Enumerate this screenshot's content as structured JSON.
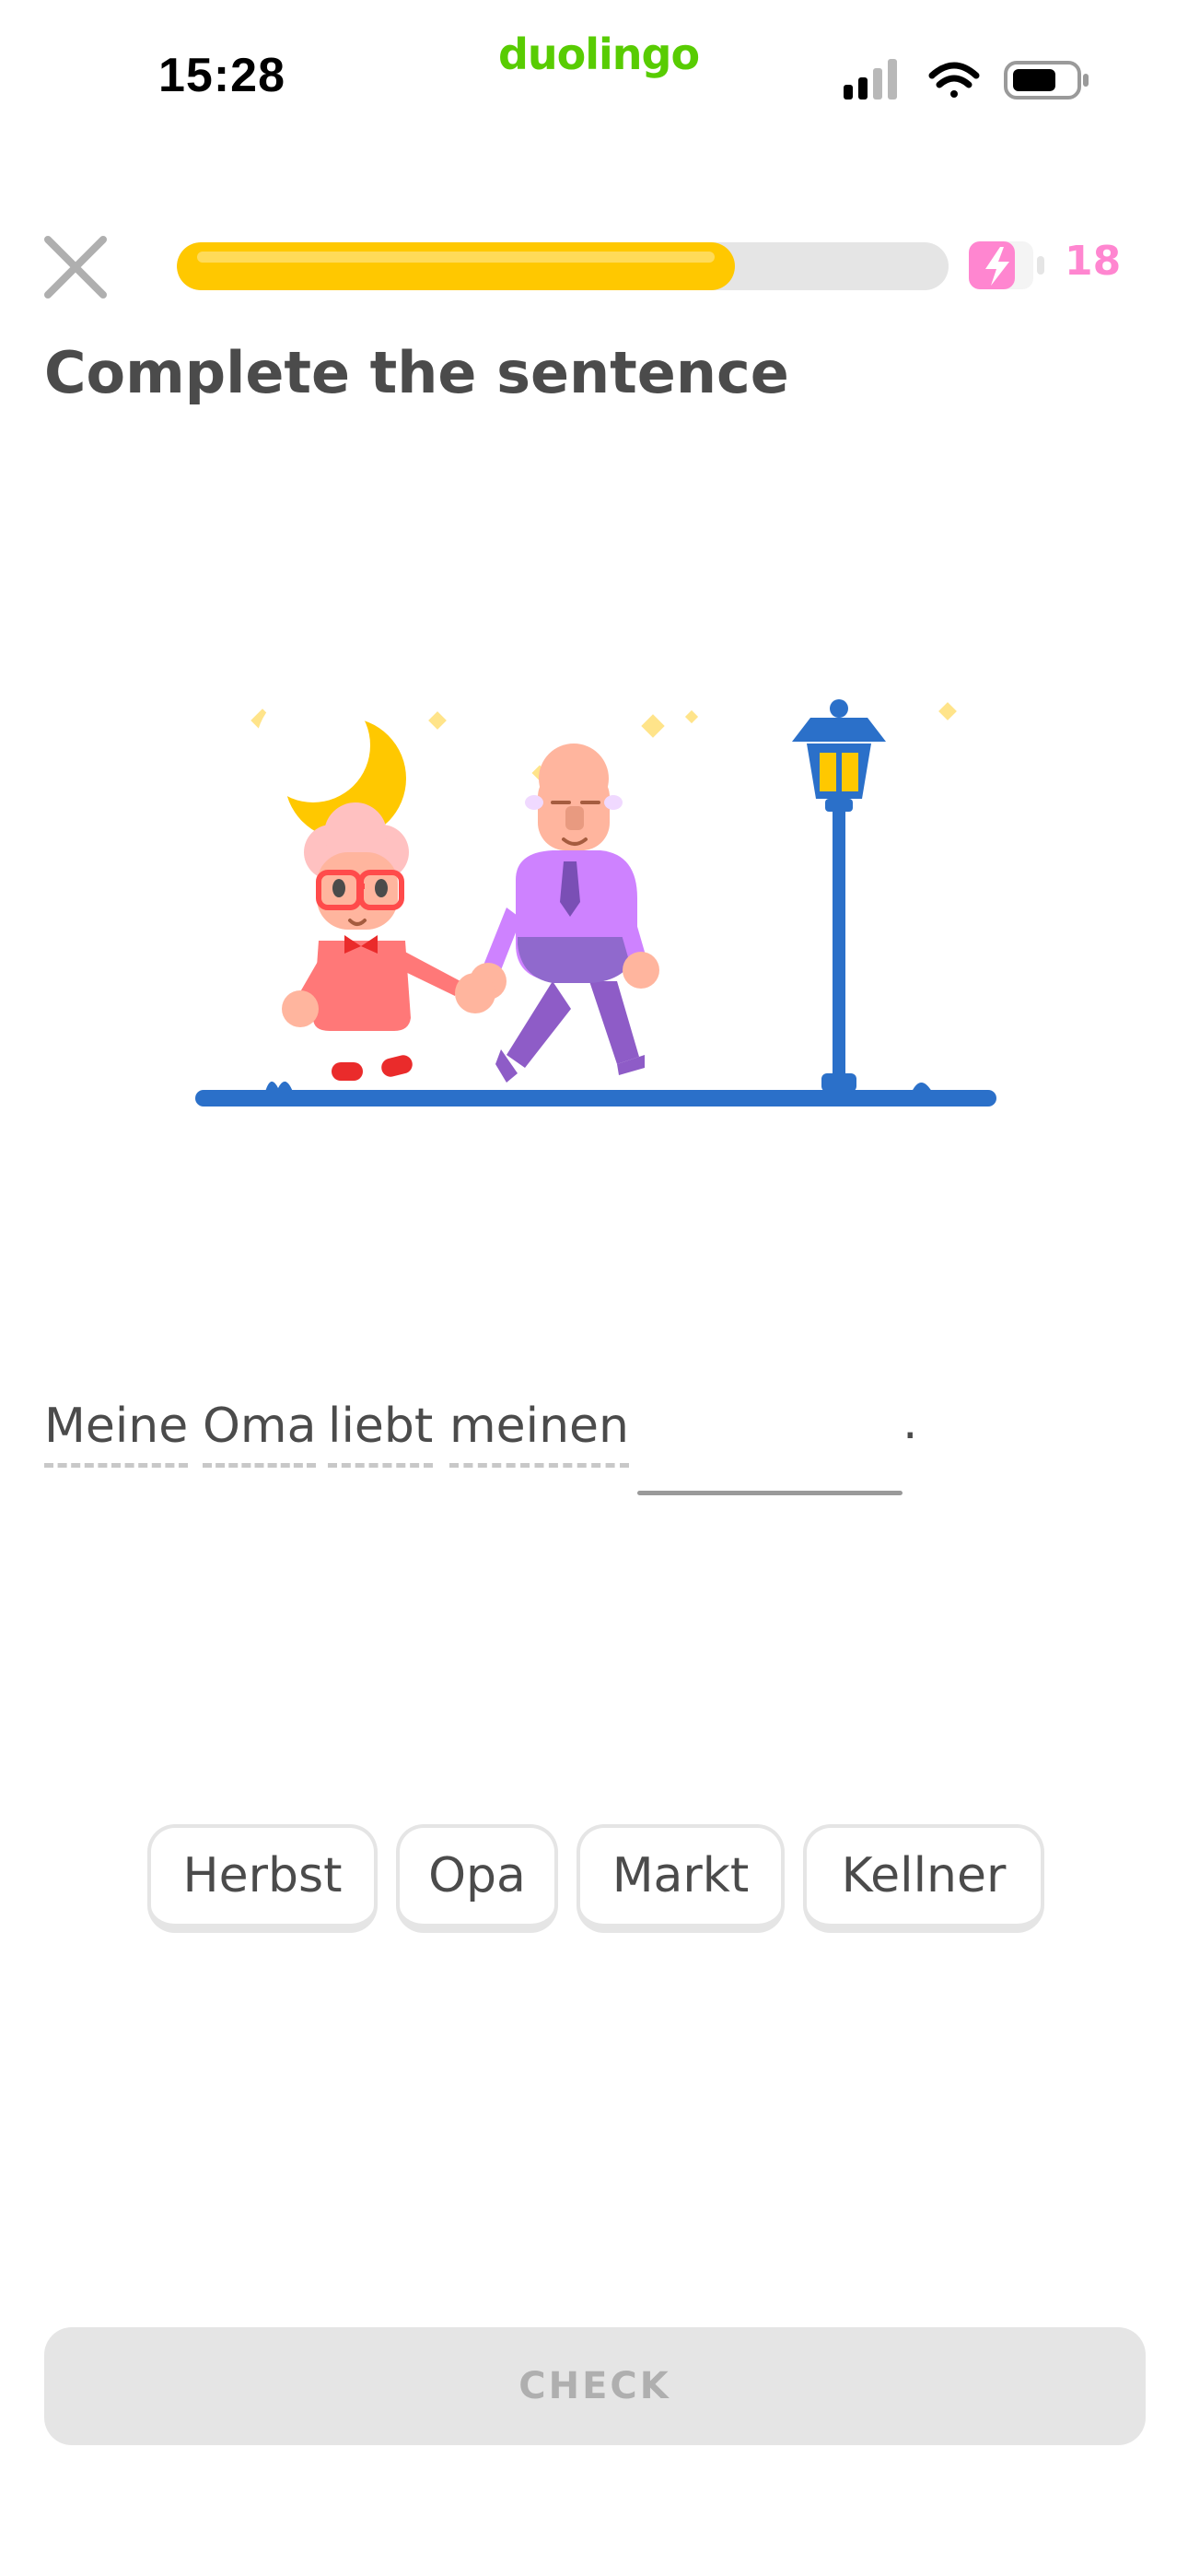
{
  "status_bar": {
    "time": "15:28",
    "app_name": "duolingo",
    "icons": [
      "signal-icon",
      "wifi-icon",
      "battery-icon"
    ]
  },
  "header": {
    "close_icon": "close-icon",
    "progress_fraction": 0.723,
    "energy_icon": "energy-battery-icon",
    "energy_count": "18"
  },
  "page_title": "Complete the sentence",
  "illustration": {
    "name": "grandparents-night-walk-illustration"
  },
  "sentence": {
    "words": [
      "Meine",
      "Oma",
      "liebt",
      "meinen"
    ],
    "blank": "",
    "end_punctuation": "."
  },
  "word_bank": [
    "Herbst",
    "Opa",
    "Markt",
    "Kellner"
  ],
  "check_label": "CHECK",
  "colors": {
    "brand_green": "#58cc02",
    "progress_yellow": "#ffc800",
    "energy_pink": "#ff86d0",
    "disabled_gray": "#e5e5e5",
    "text": "#4b4b4b"
  }
}
